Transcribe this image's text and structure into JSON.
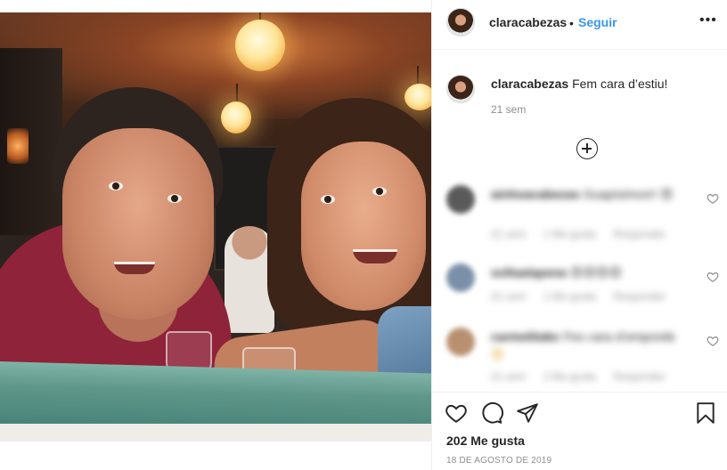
{
  "post": {
    "username": "claracabezas",
    "separator": "•",
    "follow_label": "Seguir",
    "more_options": "•••",
    "caption_username": "claracabezas",
    "caption_text": "Fem cara d’estiu!",
    "caption_time": "21 sem",
    "likes": "202 Me gusta",
    "date": "18 DE AGOSTO DE 2019"
  },
  "comments": [
    {
      "username": "ainhoacabezas",
      "text": "Guapísimos!! 😍",
      "emoji": "😍",
      "meta": [
        "21 sem",
        "1 Me gusta",
        "Responder"
      ],
      "avatar_color": "#5a5a5a"
    },
    {
      "username": "sofiaalapena",
      "text": "😍😍😍😍",
      "meta": [
        "21 sem",
        "1 Me gusta",
        "Responder"
      ],
      "avatar_color": "#7a8fa8"
    },
    {
      "username": "carmelitabc",
      "text": "Fes cara d’empordà",
      "emoji": "😍",
      "meta": [
        "21 sem",
        "2 Me gusta",
        "Responder"
      ],
      "avatar_color": "#b89070"
    }
  ],
  "icons": {
    "like": "heart-icon",
    "comment": "comment-icon",
    "share": "share-icon",
    "save": "bookmark-icon",
    "load_more": "plus-circle-icon",
    "comment_like": "heart-icon"
  },
  "colors": {
    "link_blue": "#3897f0",
    "text": "#262626",
    "secondary_text": "#8e8e8e",
    "border": "#efefef"
  }
}
